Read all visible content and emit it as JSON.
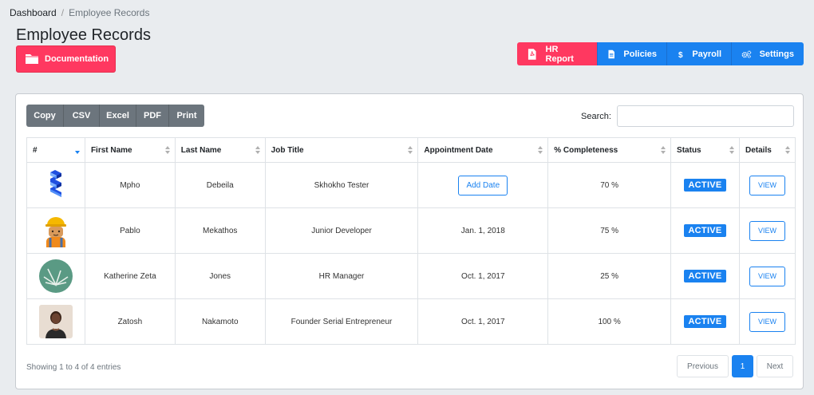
{
  "breadcrumb": {
    "home": "Dashboard",
    "separator": "/",
    "current": "Employee Records"
  },
  "page_title": "Employee Records",
  "documentation_button": "Documentation",
  "top_actions": {
    "hr_report": "HR Report",
    "policies": "Policies",
    "payroll": "Payroll",
    "settings": "Settings"
  },
  "export_buttons": [
    "Copy",
    "CSV",
    "Excel",
    "PDF",
    "Print"
  ],
  "search": {
    "label": "Search:",
    "value": "",
    "placeholder": ""
  },
  "table": {
    "columns": [
      "#",
      "First Name",
      "Last Name",
      "Job Title",
      "Appointment Date",
      "% Completeness",
      "Status",
      "Details"
    ],
    "rows": [
      {
        "avatar": "blue-blocks-avatar-icon",
        "first_name": "Mpho",
        "last_name": "Debeila",
        "job_title": "Skhokho Tester",
        "appointment_date": "",
        "appointment_action": "Add Date",
        "completeness": "70 %",
        "status": "ACTIVE",
        "details": "VIEW"
      },
      {
        "avatar": "construction-worker-avatar-icon",
        "first_name": "Pablo",
        "last_name": "Mekathos",
        "job_title": "Junior Developer",
        "appointment_date": "Jan. 1, 2018",
        "completeness": "75 %",
        "status": "ACTIVE",
        "details": "VIEW"
      },
      {
        "avatar": "aloe-plant-avatar-icon",
        "first_name": "Katherine Zeta",
        "last_name": "Jones",
        "job_title": "HR Manager",
        "appointment_date": "Oct. 1, 2017",
        "completeness": "25 %",
        "status": "ACTIVE",
        "details": "VIEW"
      },
      {
        "avatar": "person-photo-avatar",
        "first_name": "Zatosh",
        "last_name": "Nakamoto",
        "job_title": "Founder Serial Entrepreneur",
        "appointment_date": "Oct. 1, 2017",
        "completeness": "100 %",
        "status": "ACTIVE",
        "details": "VIEW"
      }
    ]
  },
  "footer": {
    "info": "Showing 1 to 4 of 4 entries",
    "previous": "Previous",
    "current_page": "1",
    "next": "Next"
  },
  "colors": {
    "danger": "#ff3860",
    "primary": "#1a82f0",
    "secondary": "#6c757d"
  }
}
